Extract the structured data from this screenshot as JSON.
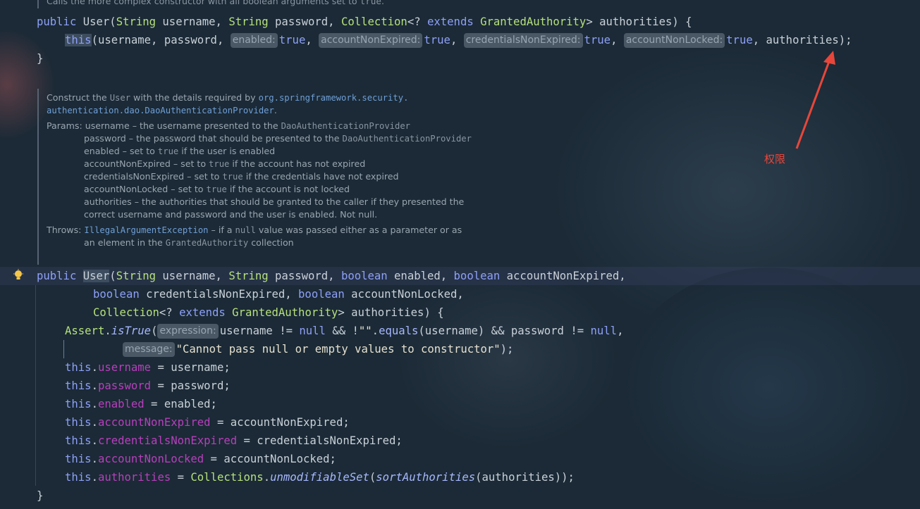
{
  "top_doc": {
    "text": "Calls the more complex constructor with all boolean arguments set to ",
    "code": "true",
    "end": "."
  },
  "ctor1": {
    "line1": {
      "kw": "public",
      "name": " User(",
      "t1": "String",
      "p1": " username, ",
      "t2": "String",
      "p2": " password, ",
      "t3": "Collection",
      "p3": "<? ",
      "kw2": "extends",
      "p4": " ",
      "t4": "GrantedAuthority",
      "p5": "> authorities) {"
    },
    "line2": {
      "this": "this",
      "open": "(username, password, ",
      "h1": "enabled:",
      "v1": "true",
      "c1": ", ",
      "h2": "accountNonExpired:",
      "v2": "true",
      "c2": ", ",
      "h3": "credentialsNonExpired:",
      "v3": "true",
      "c3": ", ",
      "h4": "accountNonLocked:",
      "v4": "true",
      "end": ", authorities);"
    },
    "close": "}"
  },
  "doc": {
    "l1a": "Construct the ",
    "l1code": "User",
    "l1b": " with the details required by ",
    "l1link": "org.springframework.security.",
    "l2link": "authentication.dao.DaoAuthenticationProvider",
    "l2b": ".",
    "params_label": "Params:",
    "p1a": "username – the username presented to the ",
    "p1code": "DaoAuthenticationProvider",
    "p2a": "password – the password that should be presented to the ",
    "p2code": "DaoAuthenticationProvider",
    "p3a": "enabled – set to ",
    "p3code": "true",
    "p3b": " if the user is enabled",
    "p4a": "accountNonExpired – set to ",
    "p4code": "true",
    "p4b": " if the account has not expired",
    "p5a": "credentialsNonExpired – set to ",
    "p5code": "true",
    "p5b": " if the credentials have not expired",
    "p6a": "accountNonLocked – set to ",
    "p6code": "true",
    "p6b": " if the account is not locked",
    "p7": "authorities – the authorities that should be granted to the caller if they presented the",
    "p8": "correct username and password and the user is enabled. Not null.",
    "throws_label": "Throws:",
    "t1link": "IllegalArgumentException",
    "t1a": " – if a ",
    "t1code": "null",
    "t1b": " value was passed either as a parameter or as",
    "t2a": "an element in the ",
    "t2code": "GrantedAuthority",
    "t2b": " collection"
  },
  "ctor2": {
    "l1": {
      "kw": "public",
      "sp": " ",
      "name": "User",
      "a": "(",
      "t1": "String",
      "b": " username, ",
      "t2": "String",
      "c": " password, ",
      "kw2": "boolean",
      "d": " enabled, ",
      "kw3": "boolean",
      "e": " accountNonExpired,"
    },
    "l2": {
      "kw": "boolean",
      "a": " credentialsNonExpired, ",
      "kw2": "boolean",
      "b": " accountNonLocked,"
    },
    "l3": {
      "t": "Collection",
      "a": "<? ",
      "kw": "extends",
      "b": " ",
      "t2": "GrantedAuthority",
      "c": "> authorities) {"
    },
    "l4": {
      "cls": "Assert",
      "dot": ".",
      "m": "isTrue",
      "a": "(",
      "h": "expression:",
      "b": "username != ",
      "kw": "null",
      "c": " && !",
      "s": "\"\"",
      "d": ".",
      "m2": "equals",
      "e": "(username) && password != ",
      "kw2": "null",
      "f": ","
    },
    "l5": {
      "h": "message:",
      "s": "\"Cannot pass null or empty values to constructor\"",
      "e": ");"
    },
    "assigns": [
      {
        "this": "this",
        "dot": ".",
        "field": "username",
        "rest": " = username;"
      },
      {
        "this": "this",
        "dot": ".",
        "field": "password",
        "rest": " = password;"
      },
      {
        "this": "this",
        "dot": ".",
        "field": "enabled",
        "rest": " = enabled;"
      },
      {
        "this": "this",
        "dot": ".",
        "field": "accountNonExpired",
        "rest": " = accountNonExpired;"
      },
      {
        "this": "this",
        "dot": ".",
        "field": "credentialsNonExpired",
        "rest": " = credentialsNonExpired;"
      },
      {
        "this": "this",
        "dot": ".",
        "field": "accountNonLocked",
        "rest": " = accountNonLocked;"
      }
    ],
    "last": {
      "this": "this",
      "dot": ".",
      "field": "authorities",
      "a": " = ",
      "cls": "Collections",
      "d": ".",
      "m": "unmodifiableSet",
      "b": "(",
      "m2": "sortAuthorities",
      "c": "(authorities));"
    },
    "close": "}"
  },
  "annotation": {
    "label": "权限",
    "color": "#e8463a"
  },
  "icons": {
    "bulb": "lightbulb-icon",
    "arrow": "red-arrow-icon"
  }
}
